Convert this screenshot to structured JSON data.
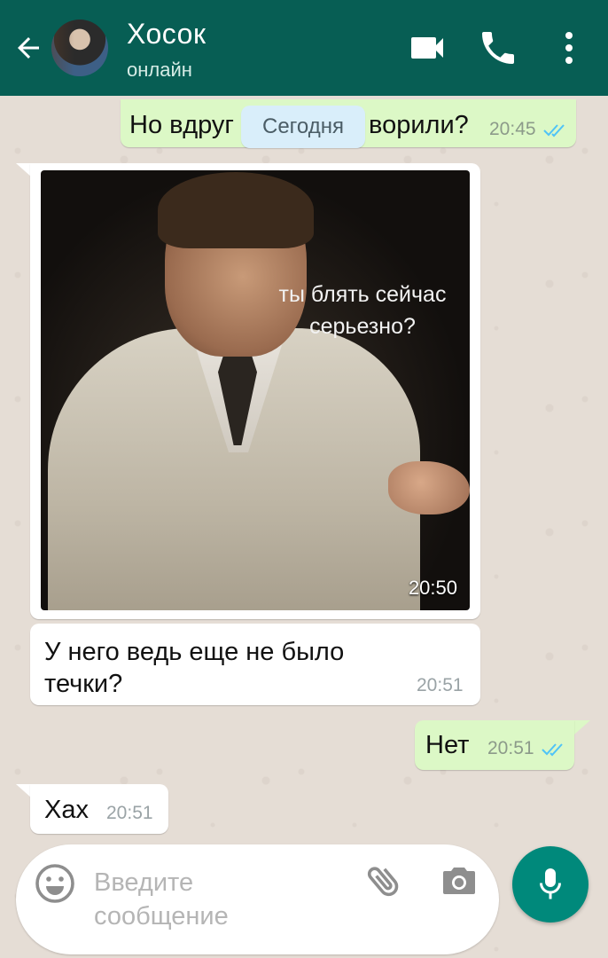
{
  "header": {
    "contact_name": "Хосок",
    "status": "онлайн",
    "color": "#075e54"
  },
  "date_chip": "Сегодня",
  "messages": [
    {
      "direction": "out",
      "text_start": "Но вдруг",
      "text_end": "ворили?",
      "time": "20:45",
      "read": true
    },
    {
      "direction": "in",
      "type": "image",
      "image_caption_line1": "ты блять сейчас",
      "image_caption_line2": "серьезно?",
      "time": "20:50"
    },
    {
      "direction": "in",
      "text": "У него ведь еще не было течки?",
      "time": "20:51"
    },
    {
      "direction": "out",
      "text": "Нет",
      "time": "20:51",
      "read": true
    },
    {
      "direction": "in",
      "text": "Хах",
      "time": "20:51"
    }
  ],
  "composer": {
    "placeholder_line1": "Введите",
    "placeholder_line2": "сообщение"
  },
  "icons": {
    "back": "arrow-left-icon",
    "video": "videocam-icon",
    "call": "phone-icon",
    "menu": "more-vert-icon",
    "emoji": "emoji-icon",
    "attach": "paperclip-icon",
    "camera": "camera-icon",
    "mic": "mic-icon"
  },
  "colors": {
    "outgoing_bubble": "#dcf8c6",
    "incoming_bubble": "#ffffff",
    "accent": "#00897b",
    "read_ticks": "#4fc3f7"
  }
}
